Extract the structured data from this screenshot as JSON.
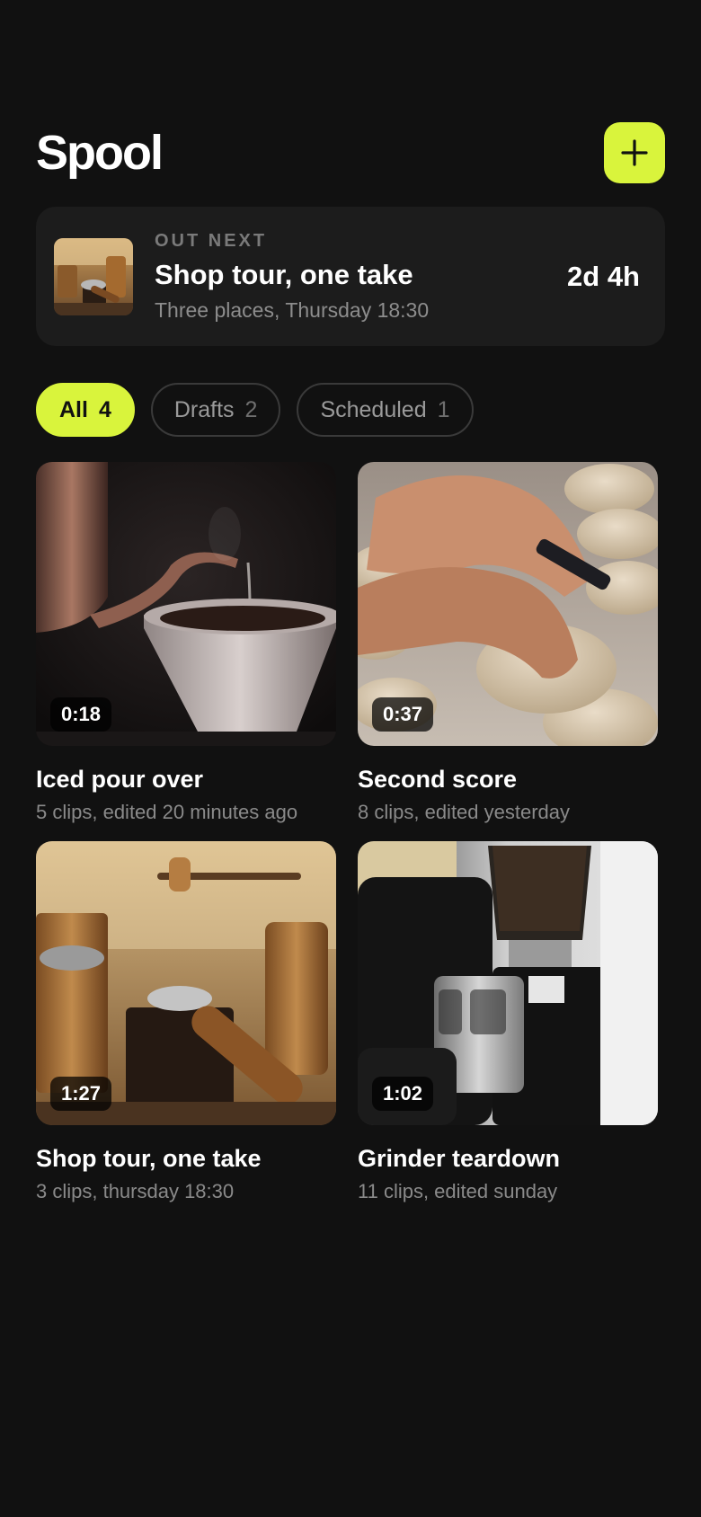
{
  "header": {
    "title": "Spool"
  },
  "out_next": {
    "eyebrow": "OUT NEXT",
    "title": "Shop tour, one take",
    "subtitle": "Three places, Thursday 18:30",
    "countdown": "2d 4h"
  },
  "filters": [
    {
      "label": "All",
      "count": "4",
      "active": true
    },
    {
      "label": "Drafts",
      "count": "2",
      "active": false
    },
    {
      "label": "Scheduled",
      "count": "1",
      "active": false
    }
  ],
  "videos": [
    {
      "title": "Iced pour over",
      "meta": "5 clips, edited 20 minutes ago",
      "duration": "0:18",
      "image": "kettle-pour-over-photo"
    },
    {
      "title": "Second score",
      "meta": "8 clips, edited yesterday",
      "duration": "0:37",
      "image": "scoring-bread-photo"
    },
    {
      "title": "Shop tour, one take",
      "meta": "3 clips, thursday 18:30",
      "duration": "1:27",
      "image": "coffee-grinders-photo"
    },
    {
      "title": "Grinder teardown",
      "meta": "11 clips, edited sunday",
      "duration": "1:02",
      "image": "espresso-grinder-photo"
    }
  ],
  "colors": {
    "accent": "#d9f43c",
    "background": "#111111",
    "card": "#1c1c1c"
  },
  "icons": {
    "add": "plus-icon"
  }
}
